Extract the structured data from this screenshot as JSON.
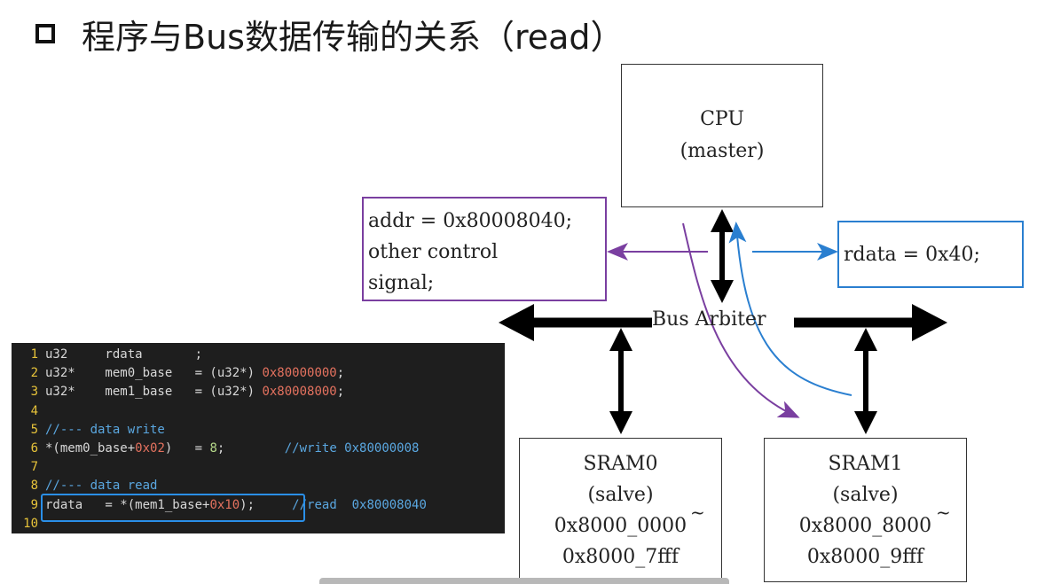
{
  "title": "程序与Bus数据传输的关系（read）",
  "cpu": {
    "line1": "CPU",
    "line2": "(master)"
  },
  "sram0": {
    "line1": "SRAM0",
    "line2": "(salve)",
    "range_start": "0x8000_0000",
    "range_end": "0x8000_7fff",
    "tilde": "~"
  },
  "sram1": {
    "line1": "SRAM1",
    "line2": "(salve)",
    "range_start": "0x8000_8000",
    "range_end": "0x8000_9fff",
    "tilde": "~"
  },
  "addr_box": {
    "line1": "addr = 0x80008040;",
    "line2": "other control",
    "line3": "signal;"
  },
  "rdata_box": {
    "text": "rdata = 0x40;"
  },
  "bus_label": "Bus Arbiter",
  "colors": {
    "request_arrow": "#7a3fa0",
    "response_arrow": "#2a7fd0",
    "bus": "#000000",
    "code_bg": "#1e1e1e"
  },
  "code": {
    "line_numbers": [
      "1",
      "2",
      "3",
      "4",
      "5",
      "6",
      "7",
      "8",
      "9",
      "10"
    ],
    "lines": [
      {
        "a": "u32     rdata       ;",
        "n": "",
        "c": ""
      },
      {
        "a": "u32*    mem0_base   = (u32*) ",
        "n": "0x80000000",
        "b": ";",
        "c": ""
      },
      {
        "a": "u32*    mem1_base   = (u32*) ",
        "n": "0x80008000",
        "b": ";",
        "c": ""
      },
      {
        "a": "",
        "n": "",
        "c": ""
      },
      {
        "a": "",
        "n": "",
        "c": "//--- data write"
      },
      {
        "a": "*(mem0_base+",
        "n": "0x02",
        "b": ")   = ",
        "d": "8",
        "e": ";        ",
        "c": "//write 0x80000008"
      },
      {
        "a": "",
        "n": "",
        "c": ""
      },
      {
        "a": "",
        "n": "",
        "c": "//--- data read"
      },
      {
        "a": "rdata   = *(mem1_base+",
        "n": "0x10",
        "b": ");     ",
        "c": "//read  0x80008040"
      },
      {
        "a": "",
        "n": "",
        "c": ""
      }
    ]
  }
}
